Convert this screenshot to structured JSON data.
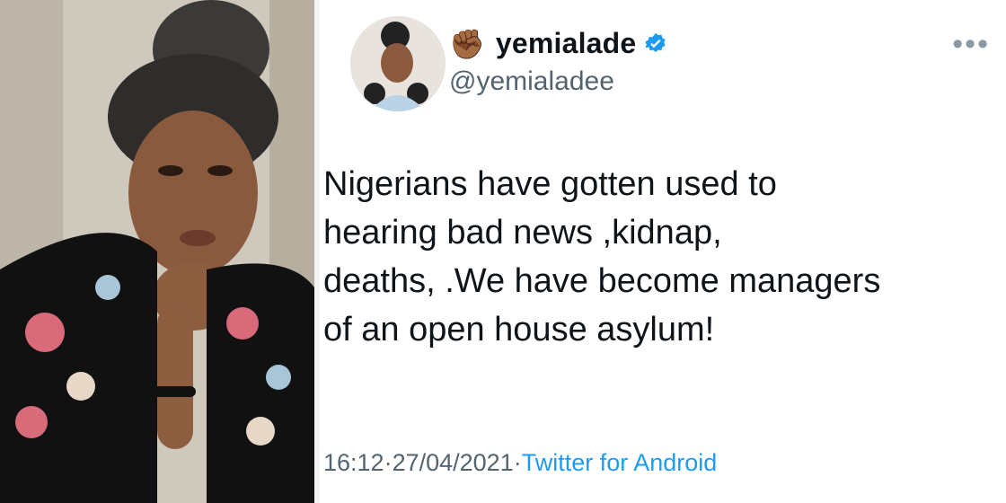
{
  "tweet": {
    "display_name": "yemialade",
    "handle": "@yemialadee",
    "name_emoji": "✊🏾",
    "verified_icon": "verified-badge-icon",
    "more_icon": "more-options-icon",
    "text_lines": [
      "Nigerians have gotten used to",
      "hearing bad news ,kidnap,",
      "deaths, .We have become managers",
      "of an open house asylum!"
    ],
    "time": "16:12",
    "separator": " · ",
    "date": "27/04/2021",
    "source": "Twitter for Android"
  },
  "colors": {
    "text": "#0f1419",
    "secondary": "#536471",
    "link": "#1d9bf0",
    "verified": "#1d9bf0"
  }
}
